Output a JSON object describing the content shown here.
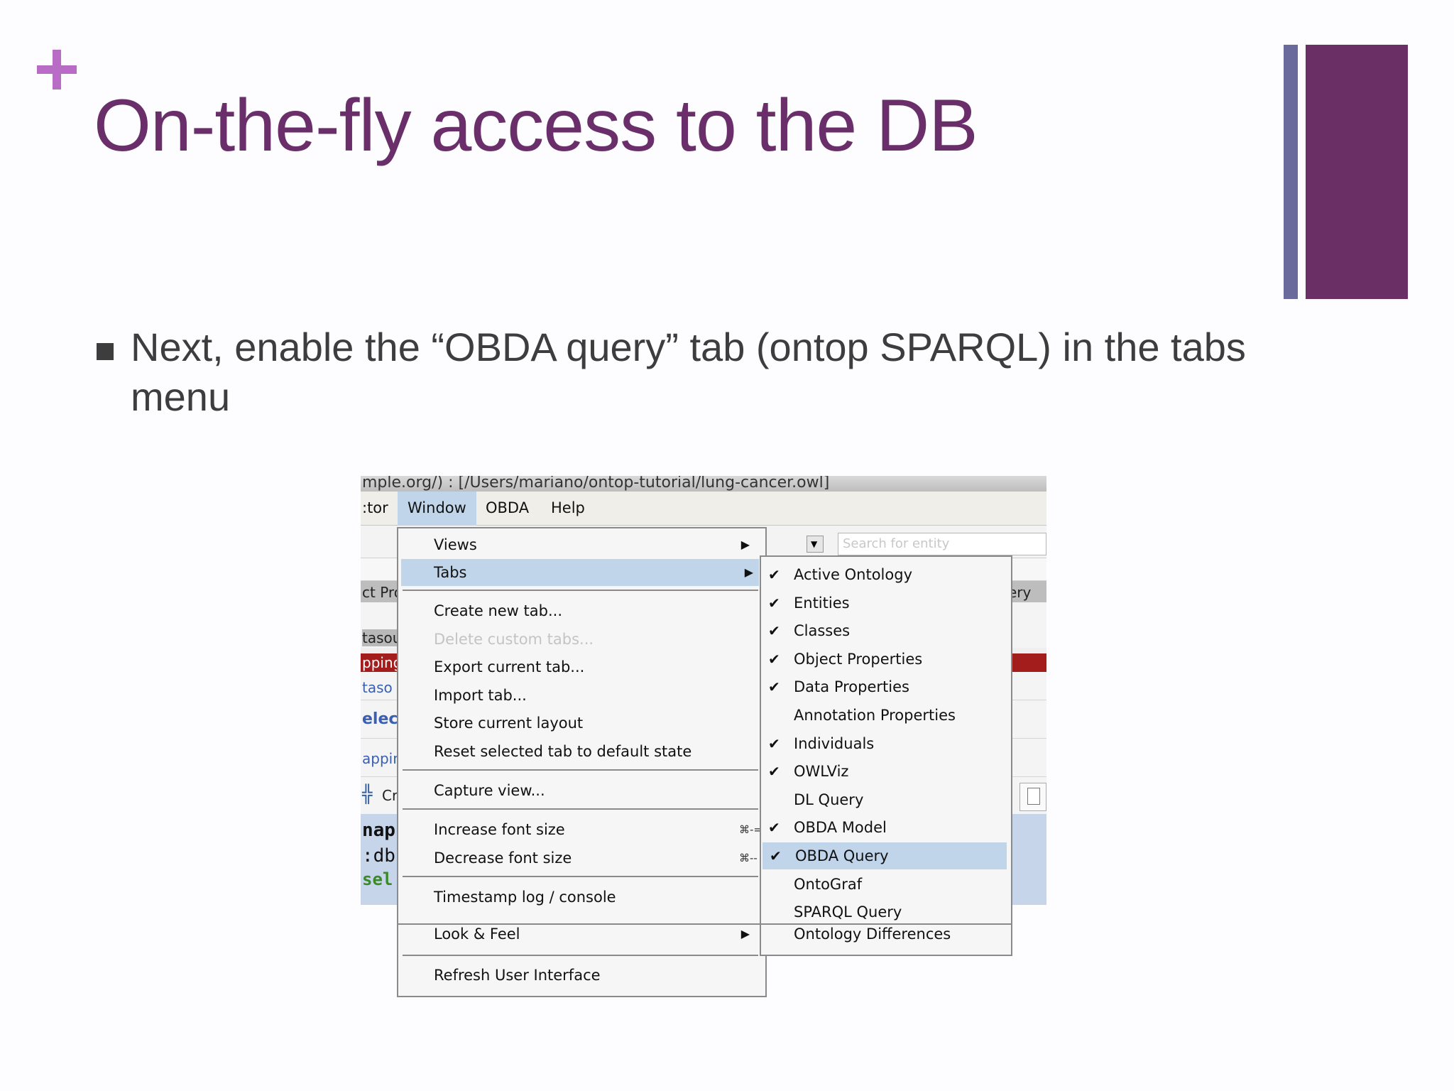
{
  "slide": {
    "title": "On-the-fly access to the DB",
    "bullet": "Next, enable the “OBDA query” tab (ontop SPARQL) in the tabs menu",
    "colors": {
      "title": "#6a2f6a",
      "plus": "#b86cc6",
      "deco_thin": "#6a6a9d",
      "deco_thick": "#6a3066",
      "bullet": "#3d3d3d"
    }
  },
  "screenshot": {
    "titlebar": "mple.org/)  : [/Users/mariano/ontop-tutorial/lung-cancer.owl]",
    "menubar": {
      "editor_fragment": ":tor",
      "window": "Window",
      "obda": "OBDA",
      "help": "Help"
    },
    "search_placeholder": "Search for entity",
    "background_fragments": {
      "tab_fragment": "ct Pro",
      "query_fragment": "ery",
      "datasource": "tasou",
      "mapping": "pping",
      "datasource2": "taso",
      "select": "elect",
      "mapping2": "appin",
      "create": "Cr",
      "map": "nap-",
      "db": ":db",
      "sel": "sel"
    },
    "window_menu": {
      "items": [
        {
          "label": "Views",
          "submenu": true
        },
        {
          "label": "Tabs",
          "submenu": true,
          "selected": true
        },
        {
          "label": "Create new tab..."
        },
        {
          "label": "Delete custom tabs...",
          "disabled": true
        },
        {
          "label": "Export current tab..."
        },
        {
          "label": "Import tab..."
        },
        {
          "label": "Store current layout"
        },
        {
          "label": "Reset selected tab to default state"
        },
        {
          "label": "Capture view..."
        },
        {
          "label": "Increase font size",
          "shortcut": "⌘-="
        },
        {
          "label": "Decrease font size",
          "shortcut": "⌘--"
        },
        {
          "label": "Timestamp log / console"
        },
        {
          "label": "Look & Feel",
          "submenu": true
        },
        {
          "label": "Refresh User Interface"
        }
      ]
    },
    "tabs_submenu": {
      "items": [
        {
          "label": "Active Ontology",
          "checked": true
        },
        {
          "label": "Entities",
          "checked": true
        },
        {
          "label": "Classes",
          "checked": true
        },
        {
          "label": "Object Properties",
          "checked": true
        },
        {
          "label": "Data Properties",
          "checked": true
        },
        {
          "label": "Annotation Properties",
          "checked": false
        },
        {
          "label": "Individuals",
          "checked": true
        },
        {
          "label": "OWLViz",
          "checked": true
        },
        {
          "label": "DL Query",
          "checked": false
        },
        {
          "label": "OBDA Model",
          "checked": true
        },
        {
          "label": "OBDA Query",
          "checked": true,
          "selected": true
        },
        {
          "label": "OntoGraf",
          "checked": false
        },
        {
          "label": "SPARQL Query",
          "checked": false
        },
        {
          "label": "Ontology Differences",
          "checked": false
        }
      ]
    },
    "check_glyph": "✔",
    "arrow_glyph": "▶"
  }
}
